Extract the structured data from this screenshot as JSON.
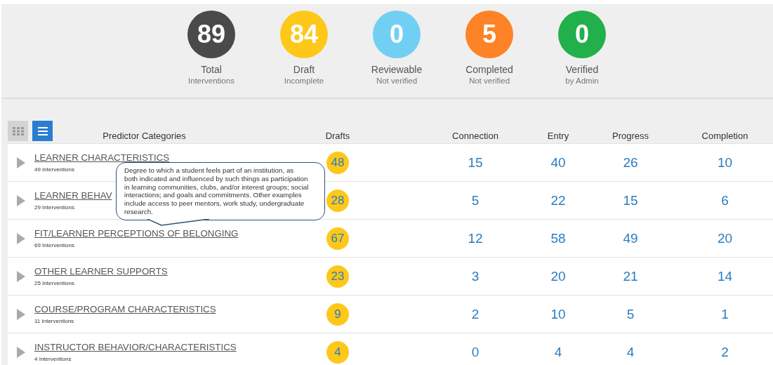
{
  "summary": [
    {
      "count": "89",
      "label": "Total",
      "sublabel": "Interventions",
      "color": "#4a4a4a"
    },
    {
      "count": "84",
      "label": "Draft",
      "sublabel": "Incomplete",
      "color": "#fec81a"
    },
    {
      "count": "0",
      "label": "Reviewable",
      "sublabel": "Not verified",
      "color": "#72cff4"
    },
    {
      "count": "5",
      "label": "Completed",
      "sublabel": "Not verified",
      "color": "#fe8226"
    },
    {
      "count": "0",
      "label": "Verified",
      "sublabel": "by Admin",
      "color": "#21b04b"
    }
  ],
  "view_buttons": [
    {
      "kind": "grid",
      "selected": false
    },
    {
      "kind": "list",
      "selected": true
    }
  ],
  "table": {
    "columns": [
      "Predictor Categories",
      "Drafts",
      "Connection",
      "Entry",
      "Progress",
      "Completion"
    ],
    "rows": [
      {
        "name": "LEARNER CHARACTERISTICS",
        "count": "49 Interventions",
        "drafts": "48",
        "connection": "15",
        "entry": "40",
        "progress": "26",
        "completion": "10"
      },
      {
        "name": "LEARNER BEHAV",
        "count": "29 Interventions",
        "drafts": "28",
        "connection": "5",
        "entry": "22",
        "progress": "15",
        "completion": "6"
      },
      {
        "name": "FIT/LEARNER PERCEPTIONS OF BELONGING",
        "count": "69 Interventions",
        "drafts": "67",
        "connection": "12",
        "entry": "58",
        "progress": "49",
        "completion": "20"
      },
      {
        "name": "OTHER LEARNER SUPPORTS",
        "count": "25 Interventions",
        "drafts": "23",
        "connection": "3",
        "entry": "20",
        "progress": "21",
        "completion": "14"
      },
      {
        "name": "COURSE/PROGRAM CHARACTERISTICS",
        "count": "11 Interventions",
        "drafts": "9",
        "connection": "2",
        "entry": "10",
        "progress": "5",
        "completion": "1"
      },
      {
        "name": "INSTRUCTOR BEHAVIOR/CHARACTERISTICS",
        "count": "4 Interventions",
        "drafts": "4",
        "connection": "0",
        "entry": "4",
        "progress": "4",
        "completion": "2"
      }
    ]
  },
  "tooltip": {
    "text": "Degree to which a student feels part of an institution, as both indicated and influenced by such things as participation in learning communities, clubs, and/or interest groups; social interactions; and goals and commitments. Other examples include access to peer mentors, work study, undergraduate research."
  }
}
